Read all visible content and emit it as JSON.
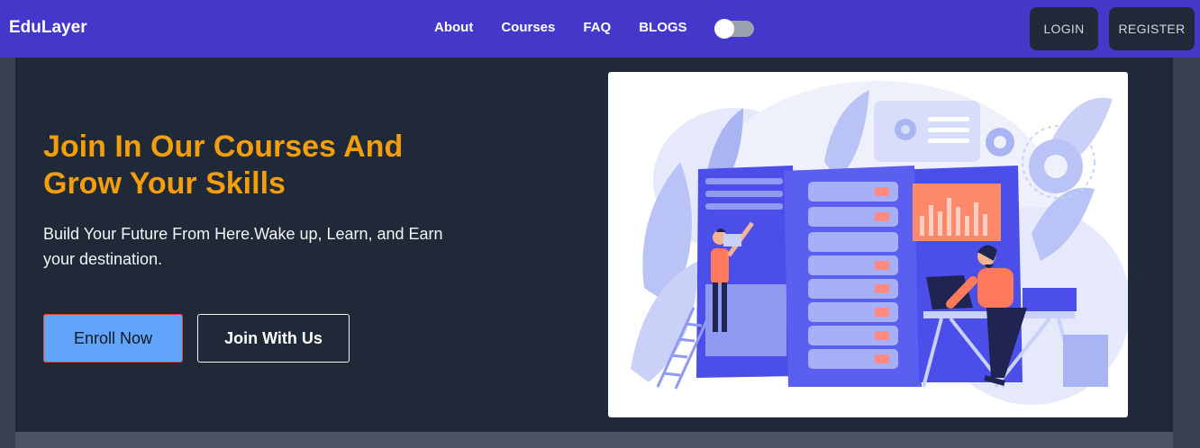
{
  "nav": {
    "brand": "EduLayer",
    "links": [
      "About",
      "Courses",
      "FAQ",
      "BLOGS"
    ],
    "login": "LOGIN",
    "register": "REGISTER"
  },
  "hero": {
    "title": "Join In Our Courses And Grow Your Skills",
    "subtitle": "Build Your Future From Here.Wake up, Learn, and Earn your destination.",
    "enroll": "Enroll Now",
    "join": "Join With Us"
  },
  "colors": {
    "navbar": "#4338ca",
    "hero_bg": "#1f2937",
    "accent": "#f59e0b",
    "enroll_bg": "#60a5fa"
  }
}
